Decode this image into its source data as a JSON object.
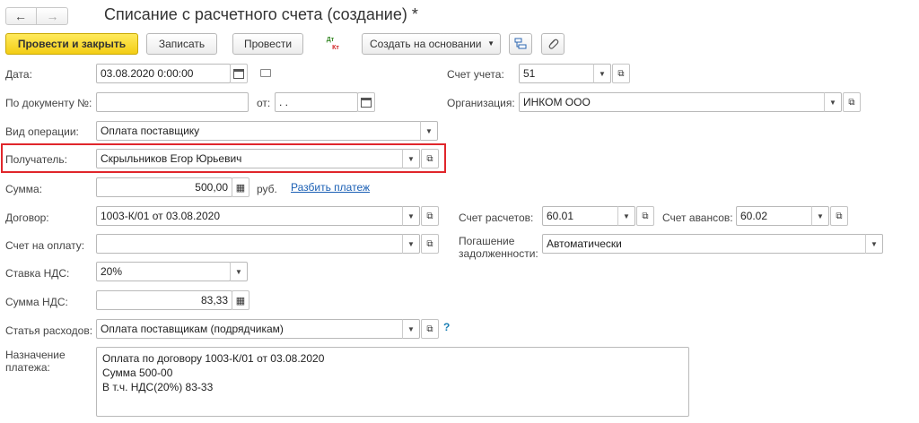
{
  "window": {
    "title": "Списание с расчетного счета (создание) *"
  },
  "nav": {
    "back": "←",
    "forward": "→"
  },
  "toolbar": {
    "post_close": "Провести и закрыть",
    "save": "Записать",
    "post": "Провести",
    "dtkt_top": "Дт",
    "dtkt_bottom": "Кт",
    "create_based": "Создать на основании"
  },
  "fields": {
    "date": {
      "label": "Дата:",
      "value": "03.08.2020  0:00:00"
    },
    "doc_number": {
      "label": "По документу №:",
      "value": "",
      "from_label": "от:",
      "from_value": " .  ."
    },
    "operation": {
      "label": "Вид операции:",
      "value": "Оплата поставщику"
    },
    "recipient": {
      "label": "Получатель:",
      "value": "Скрыльников Егор Юрьевич"
    },
    "amount": {
      "label": "Сумма:",
      "value": "500,00",
      "currency": "руб.",
      "split_link": "Разбить платеж"
    },
    "contract": {
      "label": "Договор:",
      "value": "1003-К/01 от 03.08.2020"
    },
    "invoice": {
      "label": "Счет на оплату:",
      "value": ""
    },
    "vat_rate": {
      "label": "Ставка НДС:",
      "value": "20%"
    },
    "vat_amount": {
      "label": "Сумма НДС:",
      "value": "83,33"
    },
    "expense_item": {
      "label": "Статья расходов:",
      "value": "Оплата поставщикам (подрядчикам)",
      "help": "?"
    },
    "purpose": {
      "label_line1": "Назначение",
      "label_line2": "платежа:",
      "lines": [
        "Оплата по договору 1003-К/01 от 03.08.2020",
        "Сумма 500-00",
        "В т.ч. НДС(20%) 83-33"
      ]
    },
    "account": {
      "label": "Счет учета:",
      "value": "51"
    },
    "organization": {
      "label": "Организация:",
      "value": "ИНКОМ ООО"
    },
    "settlement_account": {
      "label": "Счет расчетов:",
      "value": "60.01"
    },
    "advance_account": {
      "label": "Счет авансов:",
      "value": "60.02"
    },
    "debt_repayment": {
      "label_line1": "Погашение",
      "label_line2": "задолженности:",
      "value": "Автоматически"
    }
  },
  "colors": {
    "highlight": "#e0262b",
    "primary_button": "#f5d21e",
    "link": "#1a5fb4"
  }
}
